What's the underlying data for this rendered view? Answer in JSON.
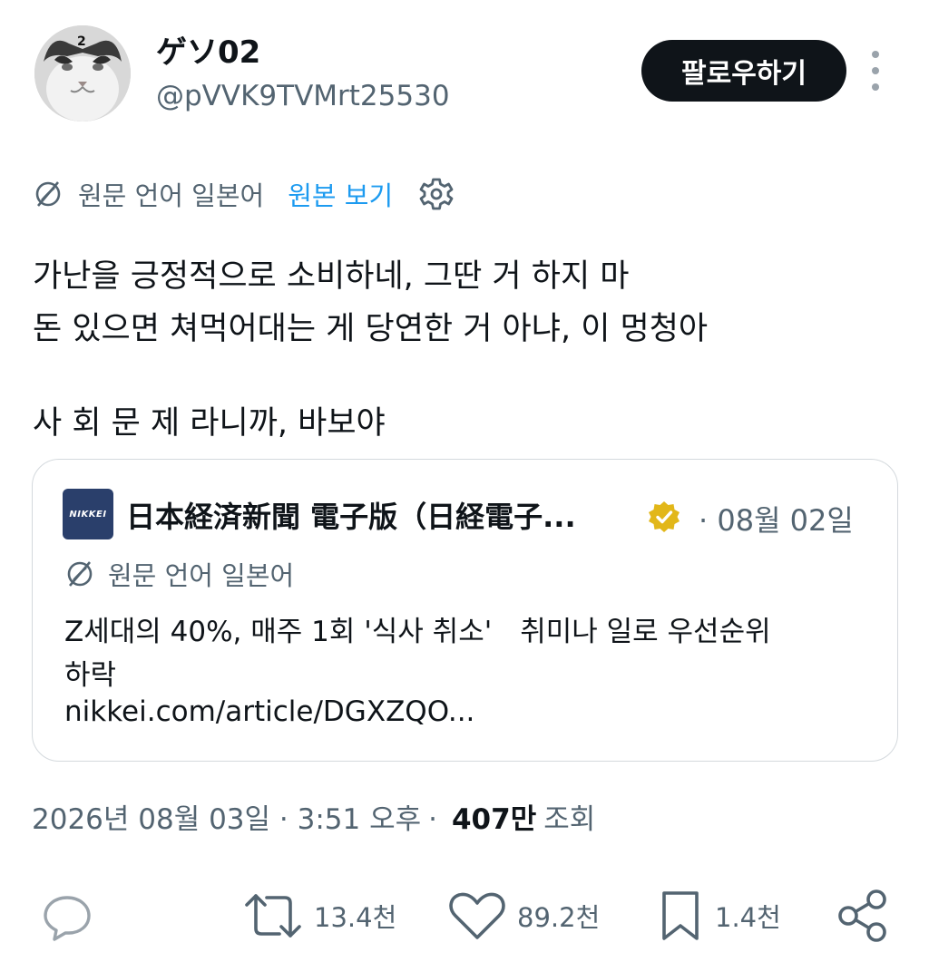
{
  "author": {
    "display_name": "ゲソ02",
    "handle": "@pVVK9TVMrt25530"
  },
  "header": {
    "follow_label": "팔로우하기"
  },
  "translation": {
    "original_language": "원문 언어 일본어",
    "show_original": "원본 보기"
  },
  "tweet": {
    "lines": [
      "가난을 긍정적으로 소비하네, 그딴 거 하지 마",
      "돈 있으면 쳐먹어대는 게 당연한 거 아냐, 이 멍청아",
      "사 회 문 제 라니까, 바보야"
    ]
  },
  "quoted": {
    "logo_text": "NIKKEI",
    "name": "日本経済新聞 電子版（日経電子...",
    "date": "· 08월 02일",
    "translation_label": "원문 언어 일본어",
    "text_lines": [
      "Z세대의 40%, 매주 1회 '식사 취소'　취미나 일로 우선순위",
      "하락"
    ],
    "link": "nikkei.com/article/DGXZQO..."
  },
  "meta": {
    "datetime": "2026년 08월 03일 · 3:51 오후",
    "separator": "·",
    "views_count": "407만",
    "views_label": "조회"
  },
  "actions": {
    "retweets": "13.4천",
    "likes": "89.2천",
    "bookmarks": "1.4천"
  },
  "colors": {
    "text": "#0f1419",
    "secondary": "#536471",
    "link_blue": "#1d9bf0",
    "verified_gold": "#e2b719",
    "border": "#d4d9dd"
  },
  "icons": [
    "translate-globe-icon",
    "settings-gear-icon",
    "verified-badge-icon",
    "reply-icon",
    "retweet-icon",
    "like-icon",
    "bookmark-icon",
    "share-icon",
    "more-icon"
  ]
}
